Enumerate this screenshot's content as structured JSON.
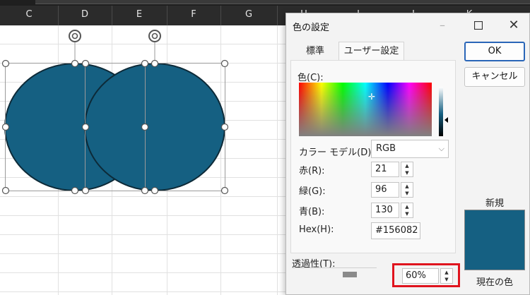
{
  "sheet": {
    "columns": [
      "C",
      "D",
      "E",
      "F",
      "G",
      "H",
      "I",
      "J",
      "K"
    ],
    "shape_fill": "#156082"
  },
  "dialog": {
    "title": "色の設定",
    "minimize_icon": "minimize-icon",
    "maximize_icon": "maximize-icon",
    "close_icon": "close-icon",
    "tabs": [
      {
        "label": "標準",
        "selected": false
      },
      {
        "label": "ユーザー設定",
        "selected": true
      }
    ],
    "color_label": "色(C):",
    "color_model_label": "カラー モデル(D):",
    "color_model_value": "RGB",
    "red_label": "赤(R):",
    "red_value": "21",
    "green_label": "緑(G):",
    "green_value": "96",
    "blue_label": "青(B):",
    "blue_value": "130",
    "hex_label": "Hex(H):",
    "hex_value": "#156082",
    "transparency_label": "透過性(T):",
    "transparency_value": "60",
    "transparency_unit": "%",
    "ok_label": "OK",
    "cancel_label": "キャンセル",
    "new_label": "新規",
    "current_label": "現在の色",
    "accent_highlight": "#e0141e",
    "selected_color": "#156082"
  }
}
